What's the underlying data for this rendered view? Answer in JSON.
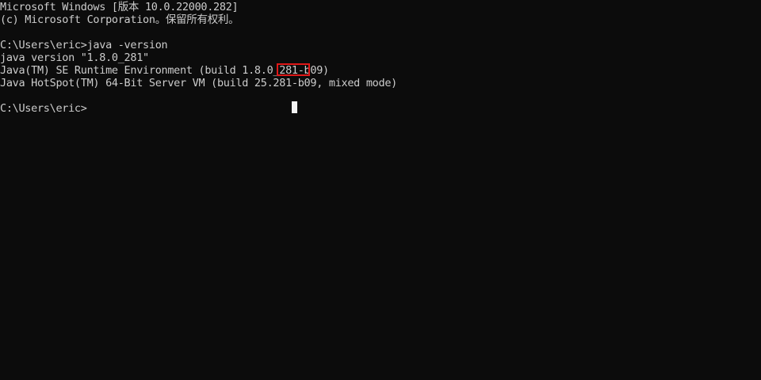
{
  "window": {
    "background_color": "#0c0c0c",
    "text_color": "#cccccc",
    "highlight_color": "#e01818"
  },
  "console": {
    "lines": [
      "Microsoft Windows [版本 10.0.22000.282]",
      "(c) Microsoft Corporation。保留所有权利。",
      "",
      "C:\\Users\\eric>java -version",
      "java version \"1.8.0_281\"",
      "Java(TM) SE Runtime Environment (build 1.8.0_281-b09)",
      "Java HotSpot(TM) 64-Bit Server VM (build 25.281-b09, mixed mode)",
      "",
      "C:\\Users\\eric>"
    ],
    "highlighted_text": "_281-"
  }
}
